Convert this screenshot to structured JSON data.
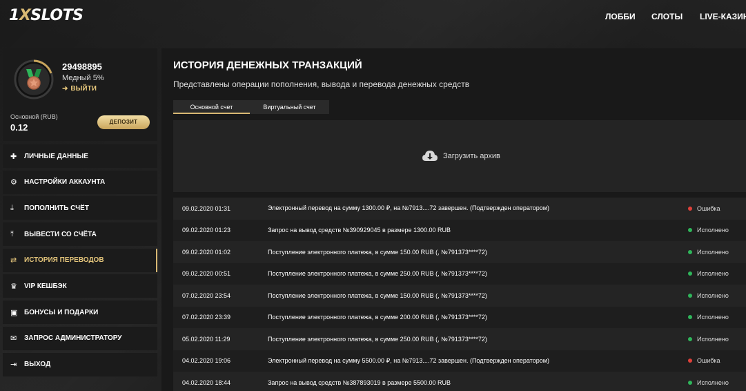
{
  "brand": {
    "logo_one": "1",
    "logo_x": "X",
    "logo_slots": "SLOTS"
  },
  "topnav": {
    "lobby": "ЛОББИ",
    "slots": "СЛОТЫ",
    "live": "LIVE-КАЗИНО"
  },
  "profile": {
    "user_id": "29498895",
    "level": "Медный 5%",
    "logout_label": "ВЫЙТИ",
    "balance_label": "Основной (RUB)",
    "balance_value": "0.12",
    "deposit_label": "ДЕПОЗИТ"
  },
  "menu": [
    {
      "label": "ЛИЧНЫЕ ДАННЫЕ",
      "icon": "user-plus-icon"
    },
    {
      "label": "НАСТРОЙКИ АККАУНТА",
      "icon": "gears-icon"
    },
    {
      "label": "ПОПОЛНИТЬ СЧЁТ",
      "icon": "download-icon"
    },
    {
      "label": "ВЫВЕСТИ СО СЧЁТА",
      "icon": "upload-icon"
    },
    {
      "label": "ИСТОРИЯ ПЕРЕВОДОВ",
      "icon": "exchange-icon",
      "active": true
    },
    {
      "label": "VIP КЕШБЭК",
      "icon": "crown-icon"
    },
    {
      "label": "БОНУСЫ И ПОДАРКИ",
      "icon": "gift-icon"
    },
    {
      "label": "ЗАПРОС АДМИНИСТРАТОРУ",
      "icon": "envelope-icon"
    },
    {
      "label": "ВЫХОД",
      "icon": "sign-out-icon"
    }
  ],
  "main": {
    "title": "ИСТОРИЯ ДЕНЕЖНЫХ ТРАНЗАКЦИЙ",
    "subtitle": "Представлены операции пополнения, вывода и перевода денежных средств",
    "tabs": [
      {
        "label": "Основной счет",
        "active": true
      },
      {
        "label": "Виртуальный счет",
        "active": false
      }
    ],
    "archive_label": "Загрузить архив"
  },
  "colors": {
    "accent": "#d8b873",
    "error": "#e0413a",
    "success": "#2fb55a"
  },
  "transactions": [
    {
      "date": "09.02.2020 01:31",
      "desc": "Электронный перевод на сумму 1300.00 ₽, на №7913....72 завершен. (Подтвержден оператором)",
      "status": "Ошибка",
      "kind": "error"
    },
    {
      "date": "09.02.2020 01:23",
      "desc": "Запрос на вывод средств №390929045 в размере 1300.00 RUB",
      "status": "Исполнено",
      "kind": "success"
    },
    {
      "date": "09.02.2020 01:02",
      "desc": "Поступление электронного платежа, в сумме 150.00 RUB (, №791373****72)",
      "status": "Исполнено",
      "kind": "success"
    },
    {
      "date": "09.02.2020 00:51",
      "desc": "Поступление электронного платежа, в сумме 250.00 RUB (, №791373****72)",
      "status": "Исполнено",
      "kind": "success"
    },
    {
      "date": "07.02.2020 23:54",
      "desc": "Поступление электронного платежа, в сумме 150.00 RUB (, №791373****72)",
      "status": "Исполнено",
      "kind": "success"
    },
    {
      "date": "07.02.2020 23:39",
      "desc": "Поступление электронного платежа, в сумме 200.00 RUB (, №791373****72)",
      "status": "Исполнено",
      "kind": "success"
    },
    {
      "date": "05.02.2020 11:29",
      "desc": "Поступление электронного платежа, в сумме 250.00 RUB (, №791373****72)",
      "status": "Исполнено",
      "kind": "success"
    },
    {
      "date": "04.02.2020 19:06",
      "desc": "Электронный перевод на сумму 5500.00 ₽, на №7913....72 завершен. (Подтвержден оператором)",
      "status": "Ошибка",
      "kind": "error"
    },
    {
      "date": "04.02.2020 18:44",
      "desc": "Запрос на вывод средств №387893019 в размере 5500.00 RUB",
      "status": "Исполнено",
      "kind": "success"
    }
  ]
}
